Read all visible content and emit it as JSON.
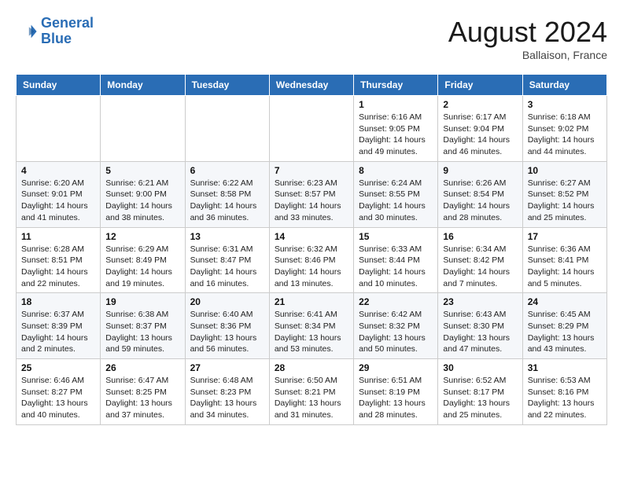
{
  "logo": {
    "line1": "General",
    "line2": "Blue"
  },
  "title": "August 2024",
  "location": "Ballaison, France",
  "weekdays": [
    "Sunday",
    "Monday",
    "Tuesday",
    "Wednesday",
    "Thursday",
    "Friday",
    "Saturday"
  ],
  "weeks": [
    [
      {
        "day": "",
        "info": ""
      },
      {
        "day": "",
        "info": ""
      },
      {
        "day": "",
        "info": ""
      },
      {
        "day": "",
        "info": ""
      },
      {
        "day": "1",
        "info": "Sunrise: 6:16 AM\nSunset: 9:05 PM\nDaylight: 14 hours\nand 49 minutes."
      },
      {
        "day": "2",
        "info": "Sunrise: 6:17 AM\nSunset: 9:04 PM\nDaylight: 14 hours\nand 46 minutes."
      },
      {
        "day": "3",
        "info": "Sunrise: 6:18 AM\nSunset: 9:02 PM\nDaylight: 14 hours\nand 44 minutes."
      }
    ],
    [
      {
        "day": "4",
        "info": "Sunrise: 6:20 AM\nSunset: 9:01 PM\nDaylight: 14 hours\nand 41 minutes."
      },
      {
        "day": "5",
        "info": "Sunrise: 6:21 AM\nSunset: 9:00 PM\nDaylight: 14 hours\nand 38 minutes."
      },
      {
        "day": "6",
        "info": "Sunrise: 6:22 AM\nSunset: 8:58 PM\nDaylight: 14 hours\nand 36 minutes."
      },
      {
        "day": "7",
        "info": "Sunrise: 6:23 AM\nSunset: 8:57 PM\nDaylight: 14 hours\nand 33 minutes."
      },
      {
        "day": "8",
        "info": "Sunrise: 6:24 AM\nSunset: 8:55 PM\nDaylight: 14 hours\nand 30 minutes."
      },
      {
        "day": "9",
        "info": "Sunrise: 6:26 AM\nSunset: 8:54 PM\nDaylight: 14 hours\nand 28 minutes."
      },
      {
        "day": "10",
        "info": "Sunrise: 6:27 AM\nSunset: 8:52 PM\nDaylight: 14 hours\nand 25 minutes."
      }
    ],
    [
      {
        "day": "11",
        "info": "Sunrise: 6:28 AM\nSunset: 8:51 PM\nDaylight: 14 hours\nand 22 minutes."
      },
      {
        "day": "12",
        "info": "Sunrise: 6:29 AM\nSunset: 8:49 PM\nDaylight: 14 hours\nand 19 minutes."
      },
      {
        "day": "13",
        "info": "Sunrise: 6:31 AM\nSunset: 8:47 PM\nDaylight: 14 hours\nand 16 minutes."
      },
      {
        "day": "14",
        "info": "Sunrise: 6:32 AM\nSunset: 8:46 PM\nDaylight: 14 hours\nand 13 minutes."
      },
      {
        "day": "15",
        "info": "Sunrise: 6:33 AM\nSunset: 8:44 PM\nDaylight: 14 hours\nand 10 minutes."
      },
      {
        "day": "16",
        "info": "Sunrise: 6:34 AM\nSunset: 8:42 PM\nDaylight: 14 hours\nand 7 minutes."
      },
      {
        "day": "17",
        "info": "Sunrise: 6:36 AM\nSunset: 8:41 PM\nDaylight: 14 hours\nand 5 minutes."
      }
    ],
    [
      {
        "day": "18",
        "info": "Sunrise: 6:37 AM\nSunset: 8:39 PM\nDaylight: 14 hours\nand 2 minutes."
      },
      {
        "day": "19",
        "info": "Sunrise: 6:38 AM\nSunset: 8:37 PM\nDaylight: 13 hours\nand 59 minutes."
      },
      {
        "day": "20",
        "info": "Sunrise: 6:40 AM\nSunset: 8:36 PM\nDaylight: 13 hours\nand 56 minutes."
      },
      {
        "day": "21",
        "info": "Sunrise: 6:41 AM\nSunset: 8:34 PM\nDaylight: 13 hours\nand 53 minutes."
      },
      {
        "day": "22",
        "info": "Sunrise: 6:42 AM\nSunset: 8:32 PM\nDaylight: 13 hours\nand 50 minutes."
      },
      {
        "day": "23",
        "info": "Sunrise: 6:43 AM\nSunset: 8:30 PM\nDaylight: 13 hours\nand 47 minutes."
      },
      {
        "day": "24",
        "info": "Sunrise: 6:45 AM\nSunset: 8:29 PM\nDaylight: 13 hours\nand 43 minutes."
      }
    ],
    [
      {
        "day": "25",
        "info": "Sunrise: 6:46 AM\nSunset: 8:27 PM\nDaylight: 13 hours\nand 40 minutes."
      },
      {
        "day": "26",
        "info": "Sunrise: 6:47 AM\nSunset: 8:25 PM\nDaylight: 13 hours\nand 37 minutes."
      },
      {
        "day": "27",
        "info": "Sunrise: 6:48 AM\nSunset: 8:23 PM\nDaylight: 13 hours\nand 34 minutes."
      },
      {
        "day": "28",
        "info": "Sunrise: 6:50 AM\nSunset: 8:21 PM\nDaylight: 13 hours\nand 31 minutes."
      },
      {
        "day": "29",
        "info": "Sunrise: 6:51 AM\nSunset: 8:19 PM\nDaylight: 13 hours\nand 28 minutes."
      },
      {
        "day": "30",
        "info": "Sunrise: 6:52 AM\nSunset: 8:17 PM\nDaylight: 13 hours\nand 25 minutes."
      },
      {
        "day": "31",
        "info": "Sunrise: 6:53 AM\nSunset: 8:16 PM\nDaylight: 13 hours\nand 22 minutes."
      }
    ]
  ]
}
